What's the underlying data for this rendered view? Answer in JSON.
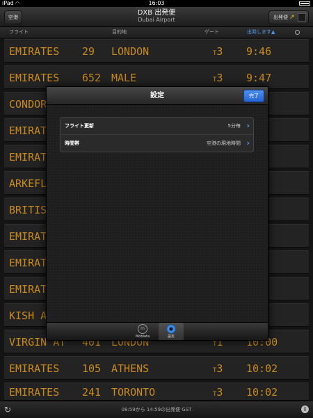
{
  "status_bar": {
    "device": "iPad",
    "time": "16:03"
  },
  "header": {
    "left_button": "空港",
    "title": "DXB 出発便",
    "subtitle": "Dubai Airport",
    "right_button": "出発便"
  },
  "columns": {
    "flight": "フライト",
    "destination": "目的地",
    "gate": "ゲート",
    "departs": "出発します▲"
  },
  "flights": [
    {
      "airline": "EMIRATES",
      "flight": "29",
      "dest": "LONDON",
      "gate_prefix": "T",
      "gate": "3",
      "time": "9:46"
    },
    {
      "airline": "EMIRATES",
      "flight": "652",
      "dest": "MALE",
      "gate_prefix": "T",
      "gate": "3",
      "time": "9:47"
    },
    {
      "airline": "CONDOR",
      "flight": "",
      "dest": "",
      "gate_prefix": "",
      "gate": "",
      "time": ""
    },
    {
      "airline": "EMIRATES",
      "flight": "",
      "dest": "",
      "gate_prefix": "",
      "gate": "",
      "time": ""
    },
    {
      "airline": "EMIRATES",
      "flight": "",
      "dest": "",
      "gate_prefix": "",
      "gate": "",
      "time": ""
    },
    {
      "airline": "ARKEFL",
      "flight": "",
      "dest": "",
      "gate_prefix": "",
      "gate": "",
      "time": ""
    },
    {
      "airline": "BRITIS",
      "flight": "",
      "dest": "",
      "gate_prefix": "",
      "gate": "",
      "time": ""
    },
    {
      "airline": "EMIRATES",
      "flight": "",
      "dest": "",
      "gate_prefix": "",
      "gate": "",
      "time": ""
    },
    {
      "airline": "EMIRATES",
      "flight": "",
      "dest": "",
      "gate_prefix": "",
      "gate": "",
      "time": ""
    },
    {
      "airline": "EMIRATES",
      "flight": "",
      "dest": "",
      "gate_prefix": "",
      "gate": "",
      "time": ""
    },
    {
      "airline": "KISH A",
      "flight": "",
      "dest": "",
      "gate_prefix": "",
      "gate": "",
      "time": ""
    },
    {
      "airline": "VIRGIN AT",
      "flight": "401",
      "dest": "LONDON",
      "gate_prefix": "T",
      "gate": "1",
      "time": "10:00"
    },
    {
      "airline": "EMIRATES",
      "flight": "105",
      "dest": "ATHENS",
      "gate_prefix": "T",
      "gate": "3",
      "time": "10:02"
    },
    {
      "airline": "EMIRATES",
      "flight": "241",
      "dest": "TORONTO",
      "gate_prefix": "T",
      "gate": "3",
      "time": "10:02"
    }
  ],
  "modal": {
    "title": "設定",
    "done_button": "完了",
    "settings": [
      {
        "label": "フライト更新",
        "value": "5分毎"
      },
      {
        "label": "時間帯",
        "value": "空港の現地時間"
      }
    ],
    "tabs": [
      {
        "label": "Mobiata",
        "icon": "mobiata-icon"
      },
      {
        "label": "設定",
        "icon": "gear-icon"
      }
    ]
  },
  "bottom_bar": {
    "range_text": "08:59から 14:59の出発便 GST"
  },
  "colors": {
    "board_text": "#c98a1d",
    "accent_blue": "#4d9cf0",
    "done_blue": "#2f6fde",
    "departures_arrow": "#f2c200"
  }
}
